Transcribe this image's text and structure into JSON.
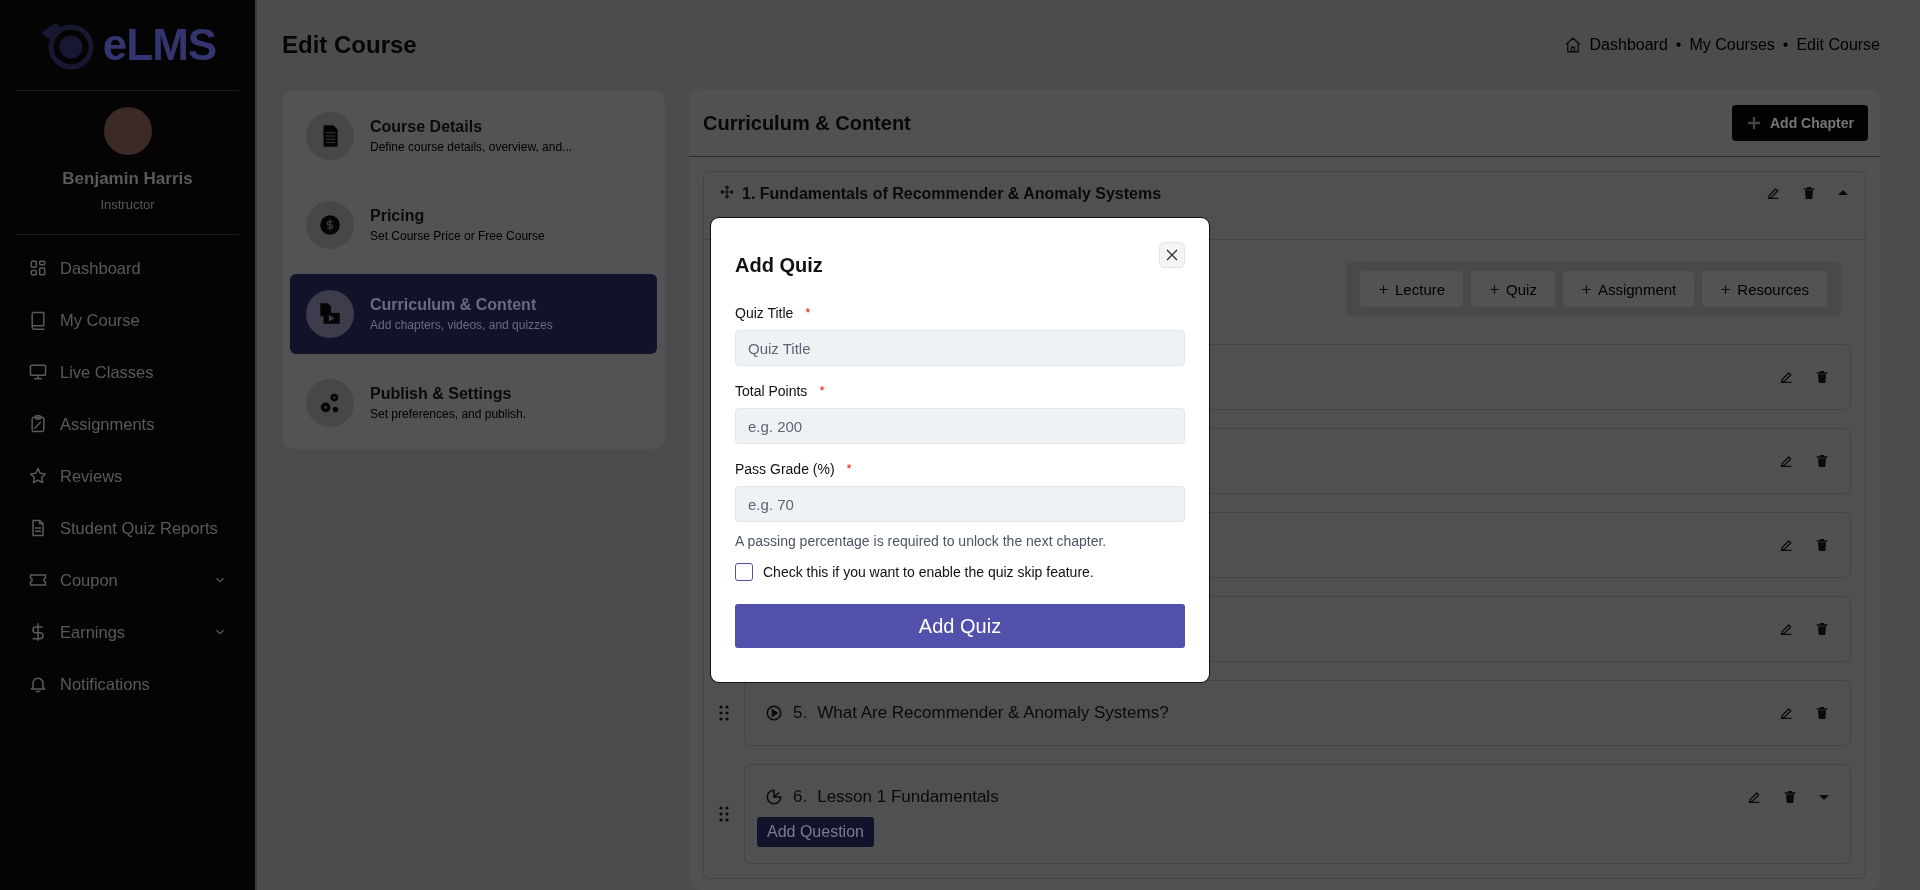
{
  "sidebar": {
    "logo_text": "eLMS",
    "user": {
      "name": "Benjamin Harris",
      "role": "Instructor"
    },
    "items": [
      {
        "label": "Dashboard",
        "expandable": false
      },
      {
        "label": "My Course",
        "expandable": false
      },
      {
        "label": "Live Classes",
        "expandable": false
      },
      {
        "label": "Assignments",
        "expandable": false
      },
      {
        "label": "Reviews",
        "expandable": false
      },
      {
        "label": "Student Quiz Reports",
        "expandable": false
      },
      {
        "label": "Coupon",
        "expandable": true
      },
      {
        "label": "Earnings",
        "expandable": true
      },
      {
        "label": "Notifications",
        "expandable": false
      }
    ]
  },
  "header": {
    "title": "Edit Course",
    "breadcrumb": [
      "Dashboard",
      "My Courses",
      "Edit Course"
    ],
    "separator": "•"
  },
  "steps": [
    {
      "title": "Course Details",
      "subtitle": "Define course details, overview, and...",
      "selected": false
    },
    {
      "title": "Pricing",
      "subtitle": "Set Course Price or Free Course",
      "selected": false
    },
    {
      "title": "Curriculum & Content",
      "subtitle": "Add chapters, videos, and quizzes",
      "selected": true
    },
    {
      "title": "Publish & Settings",
      "subtitle": "Set preferences, and publish.",
      "selected": false
    }
  ],
  "curriculum": {
    "title": "Curriculum & Content",
    "add_chapter": "Add Chapter",
    "chapter": {
      "title": "1. Fundamentals of Recommender & Anomaly Systems",
      "expanded": true,
      "add_buttons": [
        "Lecture",
        "Quiz",
        "Assignment",
        "Resources"
      ],
      "lessons": [
        {
          "expanded": false
        },
        {
          "expanded": false
        },
        {
          "expanded": false
        },
        {
          "expanded": false
        },
        {
          "kind": "video",
          "number": "5.",
          "title": "What Are Recommender & Anomaly Systems?",
          "expanded": false
        },
        {
          "kind": "quiz",
          "number": "6.",
          "title": "Lesson 1 Fundamentals",
          "expanded": true,
          "action": "Add Question"
        }
      ]
    }
  },
  "modal": {
    "title": "Add Quiz",
    "fields": [
      {
        "label": "Quiz Title",
        "required_mark": "*",
        "placeholder": "Quiz Title"
      },
      {
        "label": "Total Points",
        "required_mark": "*",
        "placeholder": "e.g. 200"
      },
      {
        "label": "Pass Grade (%)",
        "required_mark": "*",
        "placeholder": "e.g. 70"
      }
    ],
    "hint": "A passing percentage is required to unlock the next chapter.",
    "skip_checkbox": {
      "label": "Check this if you want to enable the quiz skip feature.",
      "checked": false
    },
    "submit": "Add Quiz"
  }
}
